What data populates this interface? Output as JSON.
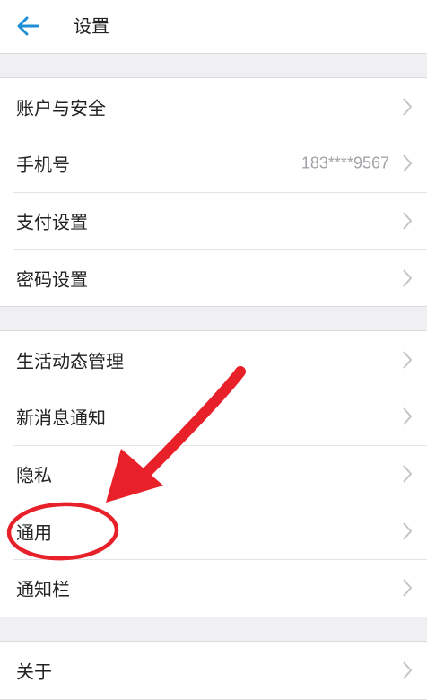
{
  "header": {
    "title": "设置",
    "back_icon": "arrow-left-icon",
    "accent_color": "#1f8ed6"
  },
  "groups": [
    {
      "items": [
        {
          "label": "账户与安全",
          "value": ""
        },
        {
          "label": "手机号",
          "value": "183****9567"
        },
        {
          "label": "支付设置",
          "value": ""
        },
        {
          "label": "密码设置",
          "value": ""
        }
      ]
    },
    {
      "items": [
        {
          "label": "生活动态管理",
          "value": ""
        },
        {
          "label": "新消息通知",
          "value": ""
        },
        {
          "label": "隐私",
          "value": ""
        },
        {
          "label": "通用",
          "value": ""
        },
        {
          "label": "通知栏",
          "value": ""
        }
      ]
    },
    {
      "items": [
        {
          "label": "关于",
          "value": ""
        }
      ]
    }
  ],
  "annotation": {
    "color": "#e8202a",
    "icons": [
      "red-arrow-icon",
      "red-circle-icon"
    ]
  }
}
